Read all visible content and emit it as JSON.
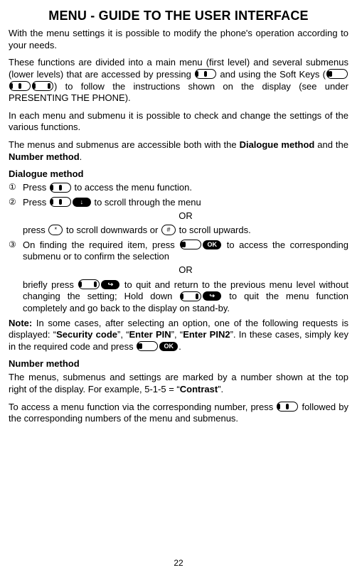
{
  "title": "MENU - GUIDE TO THE USER INTERFACE",
  "intro1": "With the menu settings it is possible to modify the phone's operation according to your needs.",
  "intro2a": "These functions are divided into a main menu (first level) and several submenus (lower levels) that are accessed by pressing ",
  "intro2b": " and using the Soft Keys (",
  "intro2c": ") to follow the instructions shown on the display (see under PRESENTING THE PHONE).",
  "intro3": "In each menu and submenu it is possible to check and change the settings of the various functions.",
  "intro4a": "The menus and submenus are accessible both with the ",
  "intro4b": "Dialogue method",
  "intro4c": " and the ",
  "intro4d": "Number method",
  "intro4e": ".",
  "dialogue_heading": "Dialogue method",
  "step1a": "Press ",
  "step1b": " to access the menu function.",
  "step2a": "Press ",
  "step2b": " to scroll through the menu",
  "or": "OR",
  "step2or_a": "press ",
  "step2or_b": " to scroll downwards or ",
  "step2or_c": " to scroll upwards.",
  "step3a": "On finding the required item, press ",
  "step3b": " to access the corresponding submenu or to confirm the selection",
  "step3or_a": "briefly press ",
  "step3or_b": " to quit and return to the previous menu level without changing the setting; Hold down ",
  "step3or_c": " to quit the menu function completely and go back to the display on stand-by.",
  "note_label": "Note:",
  "note_a": " In some cases, after selecting an option, one of the following requests is displayed: “",
  "note_sec": "Security code",
  "note_b": "”, “",
  "note_pin": "Enter PIN",
  "note_c": "”, “",
  "note_pin2": "Enter PIN2",
  "note_d": "”. In these cases, simply key in the required code and press ",
  "note_e": ".",
  "number_heading": "Number method",
  "num_p1a": "The menus, submenus and settings are marked by a number shown at the top right of the display. For example, 5-1-5 = “",
  "num_contrast": "Contrast",
  "num_p1b": "”.",
  "num_p2a": "To access a menu function via the corresponding number, press ",
  "num_p2b": " followed by the corresponding numbers of the menu and submenus.",
  "arrow_down": "↓",
  "arrow_exit": "↪",
  "star": "*",
  "hash": "#",
  "ok": "OK",
  "page_number": "22"
}
